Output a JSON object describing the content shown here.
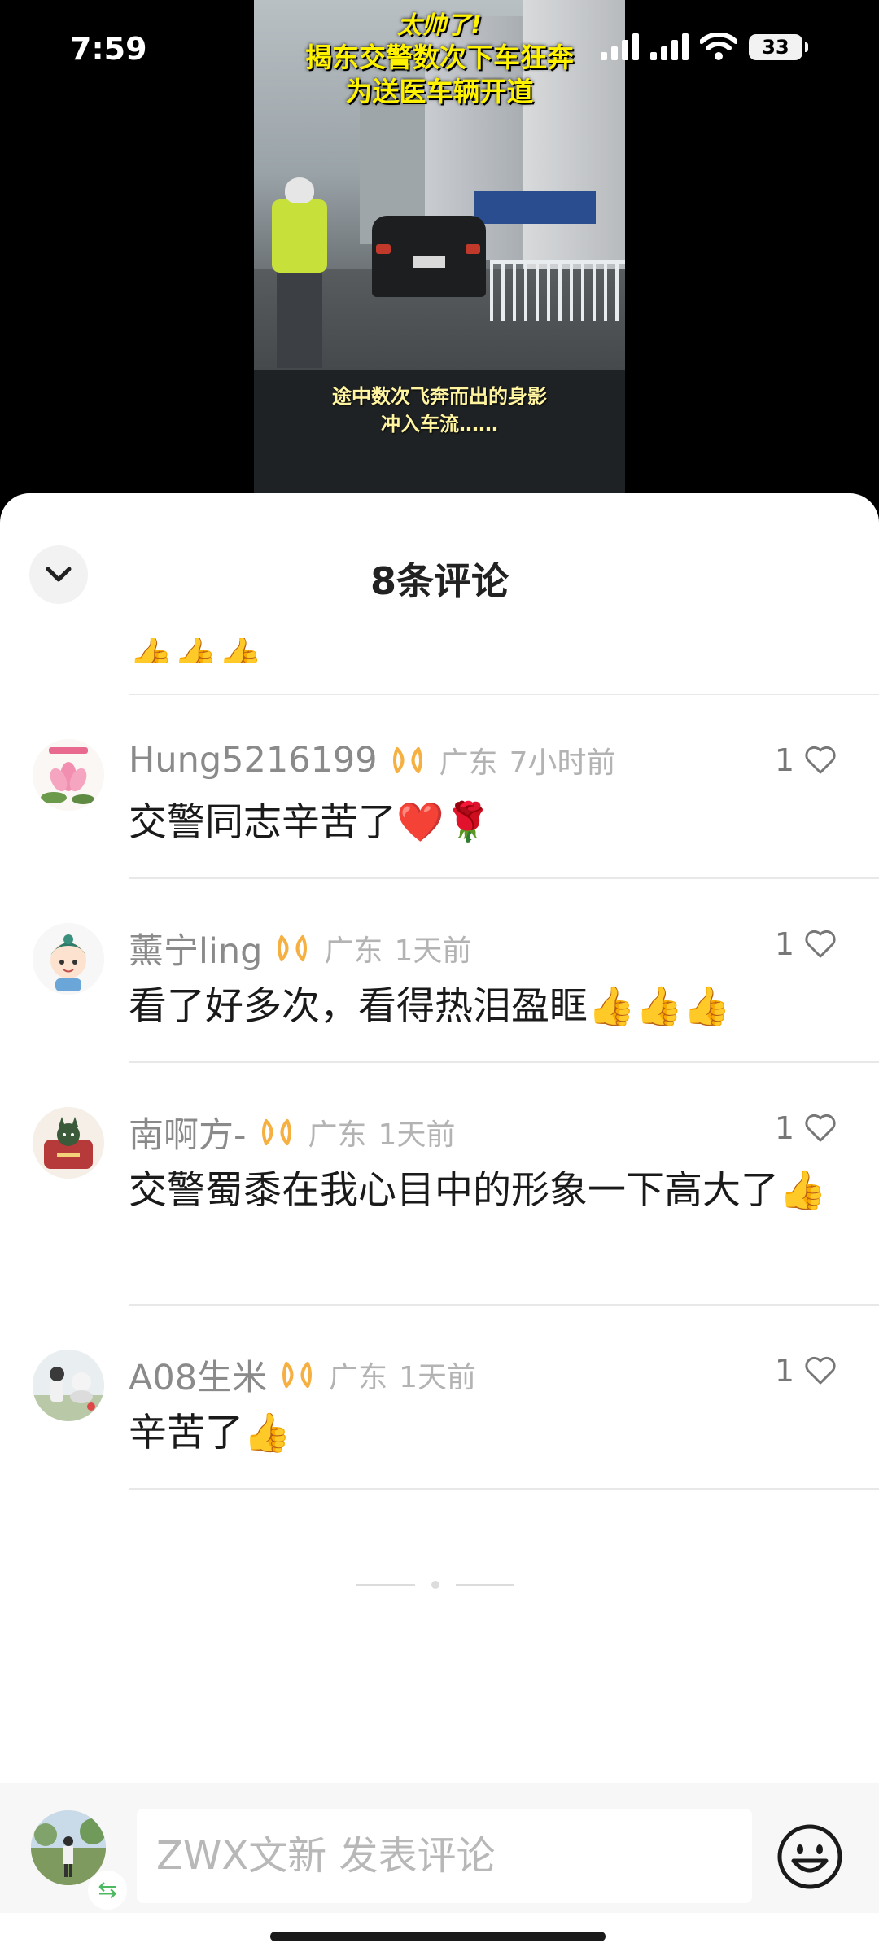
{
  "status_bar": {
    "time": "7:59",
    "battery": "33"
  },
  "video": {
    "caption_top_line1": "太帅了!",
    "caption_top_line2": "揭东交警数次下车狂奔",
    "caption_top_line3": "为送医车辆开道",
    "caption_bottom_line1": "途中数次飞奔而出的身影",
    "caption_bottom_line2": "冲入车流……"
  },
  "sheet": {
    "title": "8条评论"
  },
  "partial_prev_comment": {
    "emojis": "👍👍👍"
  },
  "comments": [
    {
      "name": "Hung5216199",
      "location": "广东",
      "time": "7小时前",
      "likes": "1",
      "text": "交警同志辛苦了❤️🌹"
    },
    {
      "name": "薰宁ling",
      "location": "广东",
      "time": "1天前",
      "likes": "1",
      "text": "看了好多次，看得热泪盈眶👍👍👍"
    },
    {
      "name": "南啊方-",
      "location": "广东",
      "time": "1天前",
      "likes": "1",
      "text": "交警蜀黍在我心目中的形象一下高大了👍"
    },
    {
      "name": "A08生米",
      "location": "广东",
      "time": "1天前",
      "likes": "1",
      "text": "辛苦了👍"
    }
  ],
  "input": {
    "placeholder": "ZWX文新 发表评论"
  },
  "icons": {
    "collapse": "chevron-down-icon",
    "like": "heart-outline-icon",
    "badge": "infinity-badge-icon",
    "emoji": "smiley-icon",
    "swap": "swap-icon"
  },
  "colors": {
    "badge": "#f5b041",
    "video_caption": "#fff200",
    "swap": "#4cb860"
  }
}
